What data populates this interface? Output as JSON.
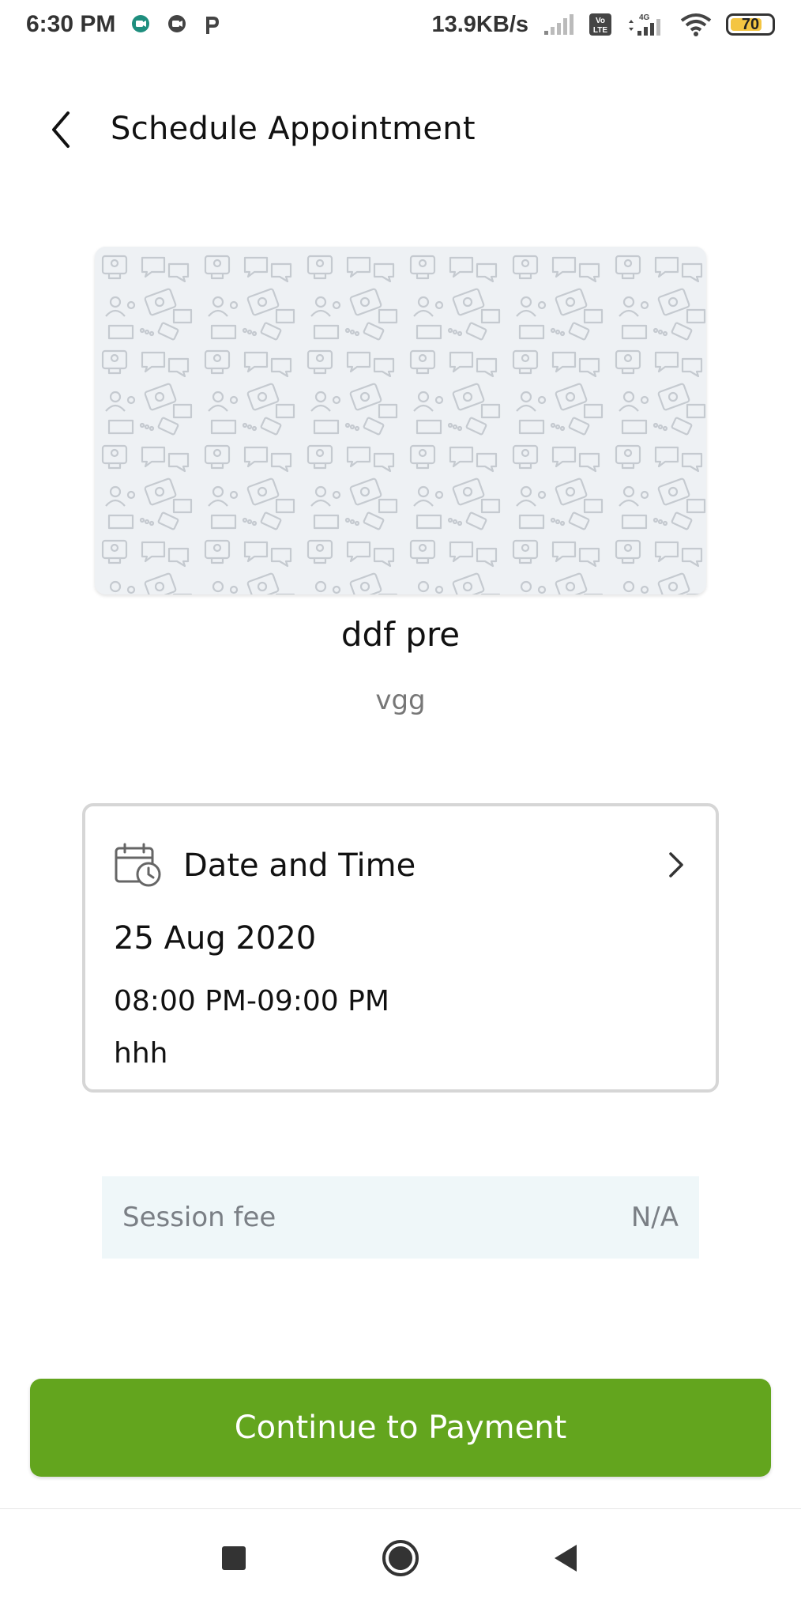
{
  "status_bar": {
    "time": "6:30 PM",
    "net_speed": "13.9KB/s",
    "volte": "Vo LTE",
    "network": "4G",
    "battery": "70"
  },
  "header": {
    "title": "Schedule Appointment"
  },
  "provider": {
    "name": "ddf pre",
    "subtitle": "vgg"
  },
  "date_time": {
    "title": "Date and Time",
    "date": "25 Aug 2020",
    "time": "08:00 PM-09:00 PM",
    "note": "hhh"
  },
  "fee": {
    "label": "Session fee",
    "value": "N/A"
  },
  "actions": {
    "continue_label": "Continue to Payment"
  },
  "colors": {
    "primary_green": "#63a51e",
    "fee_bg": "#eff7f9",
    "banner_bg": "#eef1f4"
  }
}
